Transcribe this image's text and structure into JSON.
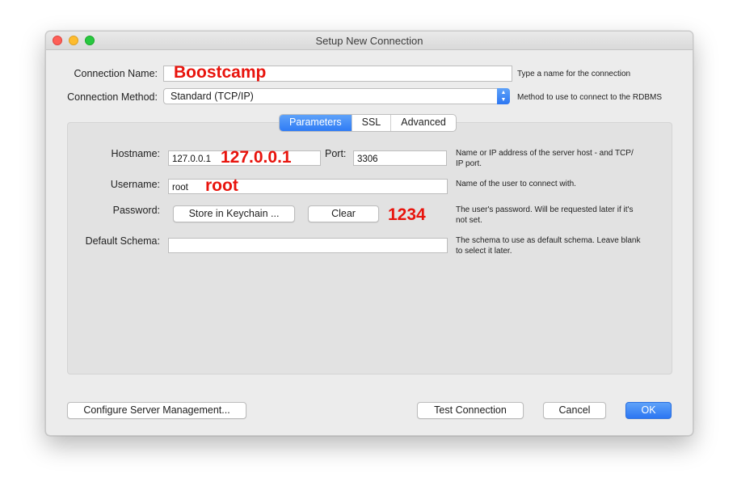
{
  "window": {
    "title": "Setup New Connection"
  },
  "connection": {
    "name_label": "Connection Name:",
    "name_value": "",
    "name_annotation": "Boostcamp",
    "name_hint": "Type a name for the connection",
    "method_label": "Connection Method:",
    "method_value": "Standard (TCP/IP)",
    "method_hint": "Method to use to connect to the RDBMS"
  },
  "tabs": [
    {
      "label": "Parameters",
      "active": true
    },
    {
      "label": "SSL",
      "active": false
    },
    {
      "label": "Advanced",
      "active": false
    }
  ],
  "parameters": {
    "hostname_label": "Hostname:",
    "hostname_value": "127.0.0.1",
    "hostname_annotation": "127.0.0.1",
    "port_label": "Port:",
    "port_value": "3306",
    "hostname_hint_line1": "Name or IP address of the server host - and TCP/",
    "hostname_hint_line2": "IP port.",
    "username_label": "Username:",
    "username_value": "root",
    "username_annotation": "root",
    "username_hint": "Name of the user to connect with.",
    "password_label": "Password:",
    "store_keychain_label": "Store in Keychain ...",
    "clear_label": "Clear",
    "password_annotation": "1234",
    "password_hint_line1": "The user's password. Will be requested later if it's",
    "password_hint_line2": "not set.",
    "schema_label": "Default Schema:",
    "schema_value": "",
    "schema_hint_line1": "The schema to use as default schema. Leave blank",
    "schema_hint_line2": "to select it later."
  },
  "footer": {
    "configure_label": "Configure Server Management...",
    "test_label": "Test Connection",
    "cancel_label": "Cancel",
    "ok_label": "OK"
  },
  "colors": {
    "accent": "#2f7bf5",
    "annotation": "#e8140d"
  }
}
